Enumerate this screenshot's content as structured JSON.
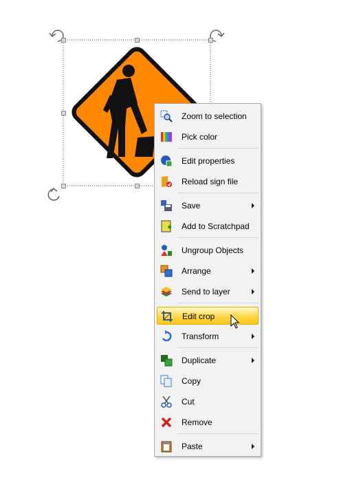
{
  "canvas": {
    "sign": {
      "body_color": "#ff8800",
      "border_color": "#111111",
      "figure_color": "#111111"
    },
    "selection": {
      "handle_count": 8,
      "rotate_handle_count": 4
    }
  },
  "context_menu": {
    "items": [
      {
        "label": "Zoom to selection",
        "icon": "zoom-to-selection-icon",
        "submenu": false
      },
      {
        "label": "Pick color",
        "icon": "pick-color-icon",
        "submenu": false
      },
      {
        "label": "Edit properties",
        "icon": "edit-properties-icon",
        "submenu": false
      },
      {
        "label": "Reload sign file",
        "icon": "reload-sign-file-icon",
        "submenu": false
      },
      {
        "label": "Save",
        "icon": "save-icon",
        "submenu": true
      },
      {
        "label": "Add to Scratchpad",
        "icon": "scratchpad-icon",
        "submenu": false
      },
      {
        "label": "Ungroup Objects",
        "icon": "ungroup-icon",
        "submenu": false
      },
      {
        "label": "Arrange",
        "icon": "arrange-icon",
        "submenu": true
      },
      {
        "label": "Send to layer",
        "icon": "layers-icon",
        "submenu": true
      },
      {
        "label": "Edit crop",
        "icon": "crop-icon",
        "submenu": false,
        "highlighted": true
      },
      {
        "label": "Transform",
        "icon": "transform-icon",
        "submenu": true
      },
      {
        "label": "Duplicate",
        "icon": "duplicate-icon",
        "submenu": true
      },
      {
        "label": "Copy",
        "icon": "copy-icon",
        "submenu": false
      },
      {
        "label": "Cut",
        "icon": "cut-icon",
        "submenu": false
      },
      {
        "label": "Remove",
        "icon": "remove-icon",
        "submenu": false
      },
      {
        "label": "Paste",
        "icon": "paste-icon",
        "submenu": true
      }
    ]
  }
}
